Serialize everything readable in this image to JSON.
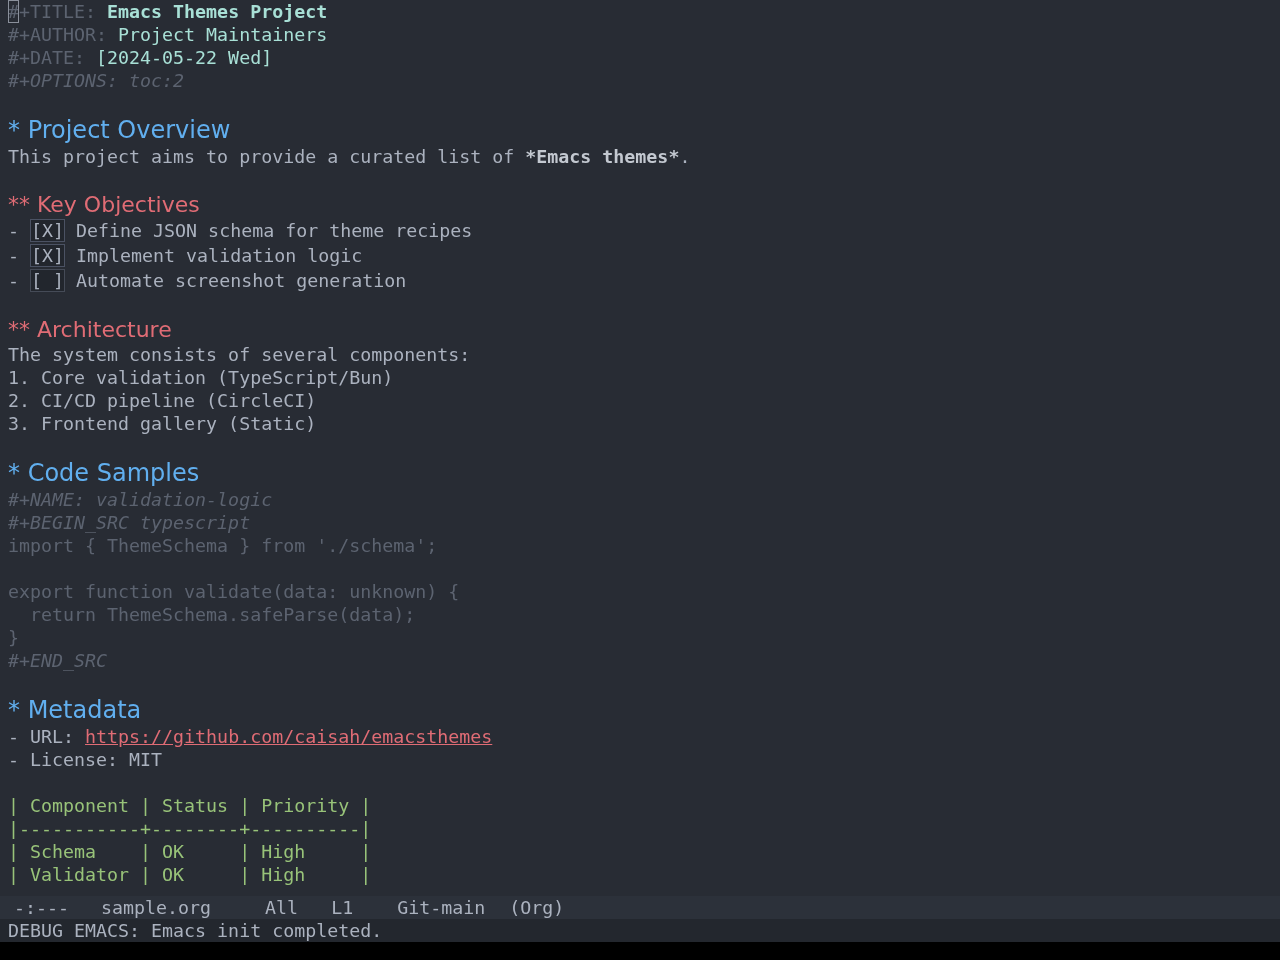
{
  "buffer": {
    "keywords": [
      {
        "kind": "title",
        "key": "#+TITLE:",
        "value": "Emacs Themes Project",
        "has_cursor": true
      },
      {
        "kind": "info",
        "key": "#+AUTHOR:",
        "value": "Project Maintainers",
        "has_cursor": false
      },
      {
        "kind": "info",
        "key": "#+DATE:",
        "value": "[2024-05-22 Wed]",
        "has_cursor": false
      },
      {
        "kind": "option",
        "key": "#+OPTIONS:",
        "value": "toc:2",
        "has_cursor": false
      }
    ],
    "sections": [
      {
        "bullet": "*",
        "title": "Project Overview",
        "blocks": [
          {
            "kind": "paragraph",
            "segments": [
              {
                "text": "This project aims to provide a curated list of ",
                "bold": false
              },
              {
                "text": "*Emacs themes*",
                "bold": true
              },
              {
                "text": ".",
                "bold": false
              }
            ]
          }
        ],
        "children": [
          {
            "bullet": "**",
            "title": "Key Objectives",
            "blocks": [
              {
                "kind": "checklist",
                "items": [
                  {
                    "bullet": "-",
                    "box": "[X]",
                    "checked": true,
                    "text": "Define JSON schema for theme recipes"
                  },
                  {
                    "bullet": "-",
                    "box": "[X]",
                    "checked": true,
                    "text": "Implement validation logic"
                  },
                  {
                    "bullet": "-",
                    "box": "[ ]",
                    "checked": false,
                    "text": "Automate screenshot generation"
                  }
                ]
              }
            ]
          },
          {
            "bullet": "**",
            "title": "Architecture",
            "blocks": [
              {
                "kind": "paragraph",
                "segments": [
                  {
                    "text": "The system consists of several components:",
                    "bold": false
                  }
                ]
              },
              {
                "kind": "ordered_list",
                "items": [
                  {
                    "number": "1.",
                    "text": "Core validation (TypeScript/Bun)"
                  },
                  {
                    "number": "2.",
                    "text": "CI/CD pipeline (CircleCI)"
                  },
                  {
                    "number": "3.",
                    "text": "Frontend gallery (Static)"
                  }
                ]
              }
            ]
          }
        ]
      },
      {
        "bullet": "*",
        "title": "Code Samples",
        "blocks": [
          {
            "kind": "src",
            "name_line": "#+NAME: validation-logic",
            "begin": "#+BEGIN_SRC typescript",
            "chunks": [
              [
                "import { ThemeSchema } from './schema';"
              ],
              [
                "export function validate(data: unknown) {",
                "  return ThemeSchema.safeParse(data);",
                "}"
              ]
            ],
            "end": "#+END_SRC"
          }
        ]
      },
      {
        "bullet": "*",
        "title": "Metadata",
        "blocks": [
          {
            "kind": "list",
            "items": [
              {
                "kind": "link",
                "bullet": "-",
                "label": "URL:",
                "value": "https://github.com/caisah/emacsthemes"
              },
              {
                "kind": "text",
                "bullet": "-",
                "label": "License:",
                "value": "MIT"
              }
            ]
          },
          {
            "kind": "table",
            "header": "| Component | Status | Priority |",
            "rule": "|-----------+--------+----------|",
            "rows": [
              "| Schema    | OK     | High     |",
              "| Validator | OK     | High     |"
            ]
          }
        ]
      }
    ]
  },
  "mode_line": {
    "state": "-:---",
    "buffer_name": "sample.org",
    "position": "All",
    "line": "L1",
    "branch": "Git-main",
    "major_mode": "(Org)"
  },
  "echo_area": "DEBUG EMACS: Emacs init completed."
}
